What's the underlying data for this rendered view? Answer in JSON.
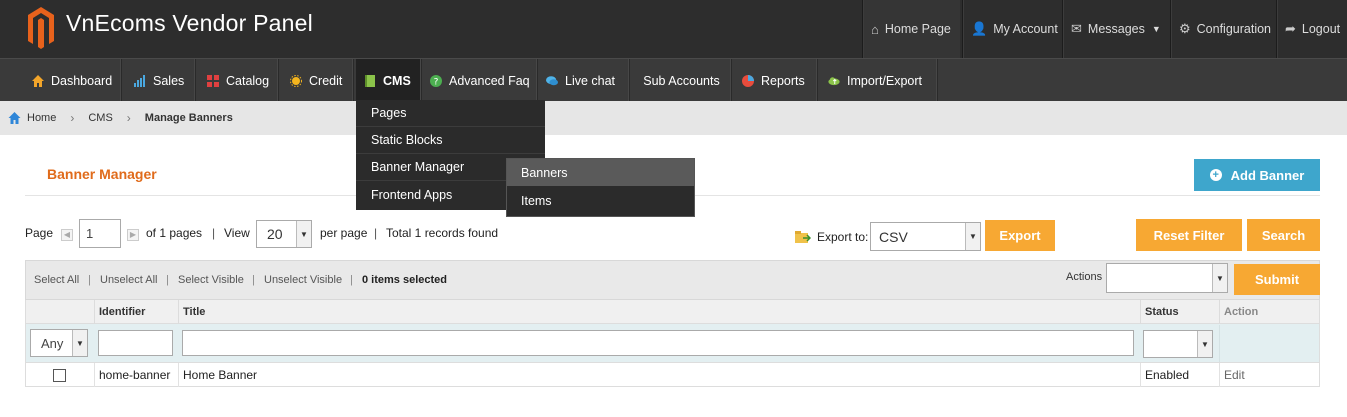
{
  "header": {
    "brand": "VnEcoms Vendor Panel",
    "links": {
      "home": "Home Page",
      "account": "My Account",
      "messages": "Messages",
      "config": "Configuration",
      "logout": "Logout"
    }
  },
  "nav": {
    "dashboard": "Dashboard",
    "sales": "Sales",
    "catalog": "Catalog",
    "credit": "Credit",
    "cms": "CMS",
    "faq": "Advanced Faq",
    "livechat": "Live chat",
    "subaccounts": "Sub Accounts",
    "reports": "Reports",
    "import": "Import/Export"
  },
  "cms_menu": {
    "items": [
      "Pages",
      "Static Blocks",
      "Banner Manager",
      "Frontend Apps"
    ],
    "submenu": [
      "Banners",
      "Items"
    ]
  },
  "breadcrumb": {
    "home": "Home",
    "cms": "CMS",
    "current": "Manage Banners"
  },
  "page": {
    "title": "Banner Manager",
    "add_button": "Add Banner"
  },
  "pager": {
    "page_label": "Page",
    "page_value": "1",
    "of_pages": "of 1 pages",
    "view_label": "View",
    "view_value": "20",
    "per_page": "per page",
    "total": "Total 1 records found",
    "export_label": "Export to:",
    "export_value": "CSV",
    "export_button": "Export",
    "reset_button": "Reset Filter",
    "search_button": "Search"
  },
  "massaction": {
    "select_all": "Select All",
    "unselect_all": "Unselect All",
    "select_visible": "Select Visible",
    "unselect_visible": "Unselect Visible",
    "selected": "0 items selected",
    "actions_label": "Actions",
    "submit": "Submit"
  },
  "grid": {
    "columns": {
      "identifier": "Identifier",
      "title": "Title",
      "status": "Status",
      "action": "Action"
    },
    "filter_any": "Any",
    "rows": [
      {
        "identifier": "home-banner",
        "title": "Home Banner",
        "status": "Enabled",
        "action": "Edit"
      }
    ]
  },
  "colors": {
    "accent_orange": "#f7a833",
    "title_orange": "#e06b1b",
    "add_blue": "#3ea6cc",
    "header_dark": "#2d2d2d",
    "nav_dark": "#3a3a3a"
  }
}
